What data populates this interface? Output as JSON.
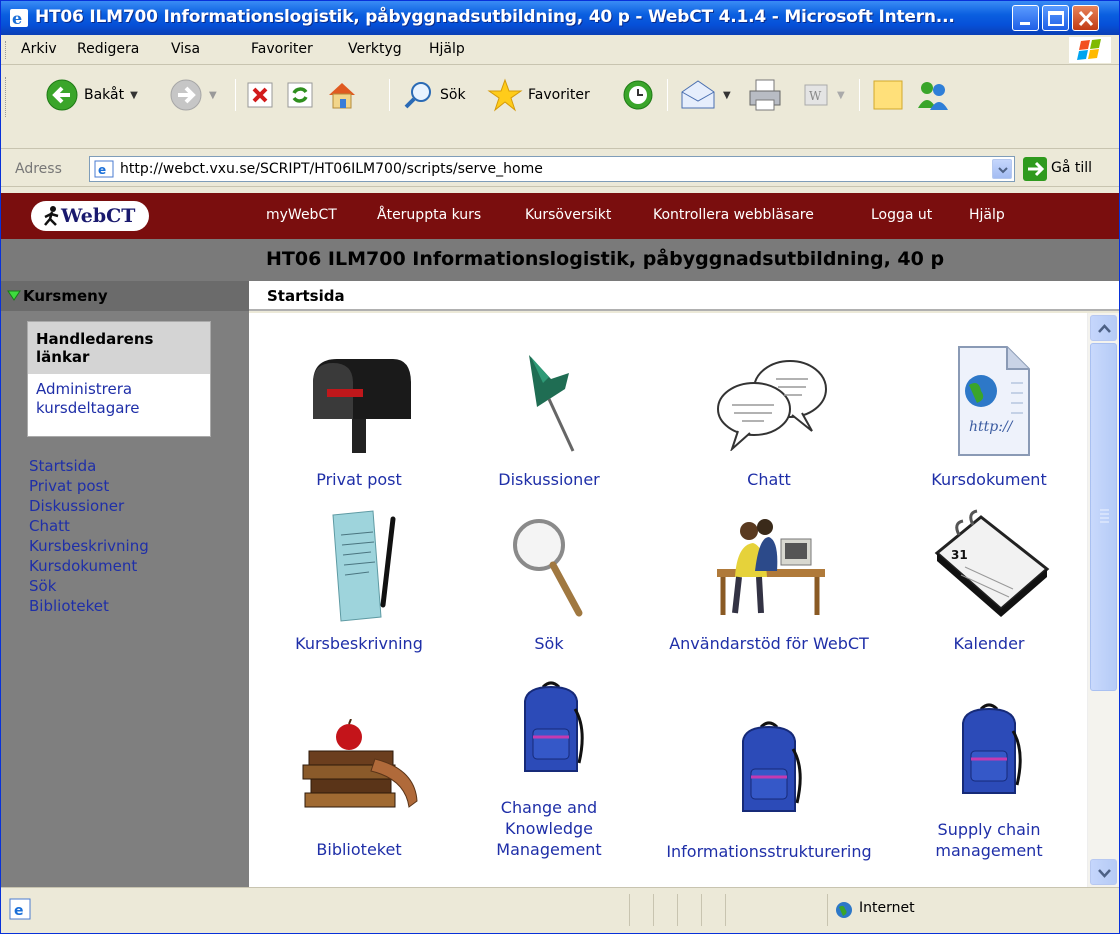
{
  "window": {
    "title": "HT06 ILM700 Informationslogistik, påbyggnadsutbildning, 40 p - WebCT 4.1.4 - Microsoft Intern..."
  },
  "menubar": {
    "items": [
      "Arkiv",
      "Redigera",
      "Visa",
      "Favoriter",
      "Verktyg",
      "Hjälp"
    ]
  },
  "toolbar": {
    "back_label": "Bakåt",
    "search_label": "Sök",
    "favorites_label": "Favoriter"
  },
  "address": {
    "label": "Adress",
    "url": "http://webct.vxu.se/SCRIPT/HT06ILM700/scripts/serve_home",
    "go_label": "Gå till"
  },
  "webct": {
    "logo_text": "WebCT",
    "nav": [
      "myWebCT",
      "Återuppta kurs",
      "Kursöversikt",
      "Kontrollera webbläsare",
      "Logga ut",
      "Hjälp"
    ],
    "course_title": "HT06 ILM700 Informationslogistik, påbyggnadsutbildning, 40 p"
  },
  "left": {
    "menu_title": "Kursmeny",
    "instructor_box": {
      "title_line1": "Handledarens",
      "title_line2": "länkar",
      "link_line1": "Administrera",
      "link_line2": "kursdeltagare"
    },
    "links": [
      "Startsida",
      "Privat post",
      "Diskussioner",
      "Chatt",
      "Kursbeskrivning",
      "Kursdokument",
      "Sök",
      "Biblioteket"
    ]
  },
  "main": {
    "section_title": "Startsida",
    "tools": [
      {
        "label": "Privat post",
        "icon": "mailbox-icon"
      },
      {
        "label": "Diskussioner",
        "icon": "pushpin-icon"
      },
      {
        "label": "Chatt",
        "icon": "chat-bubbles-icon"
      },
      {
        "label": "Kursdokument",
        "icon": "document-icon"
      },
      {
        "label": "Kursbeskrivning",
        "icon": "notepad-pen-icon"
      },
      {
        "label": "Sök",
        "icon": "magnifier-icon"
      },
      {
        "label": "Användarstöd för WebCT",
        "icon": "people-at-computer-icon"
      },
      {
        "label": "Kalender",
        "icon": "calendar-icon"
      },
      {
        "label": "Biblioteket",
        "icon": "books-apple-icon"
      },
      {
        "label_lines": [
          "Change and",
          "Knowledge",
          "Management"
        ],
        "icon": "backpack-icon"
      },
      {
        "label": "Informationsstrukturering",
        "icon": "backpack-icon"
      },
      {
        "label_lines": [
          "Supply chain",
          "management"
        ],
        "icon": "backpack-icon"
      }
    ]
  },
  "status": {
    "zone_label": "Internet"
  }
}
